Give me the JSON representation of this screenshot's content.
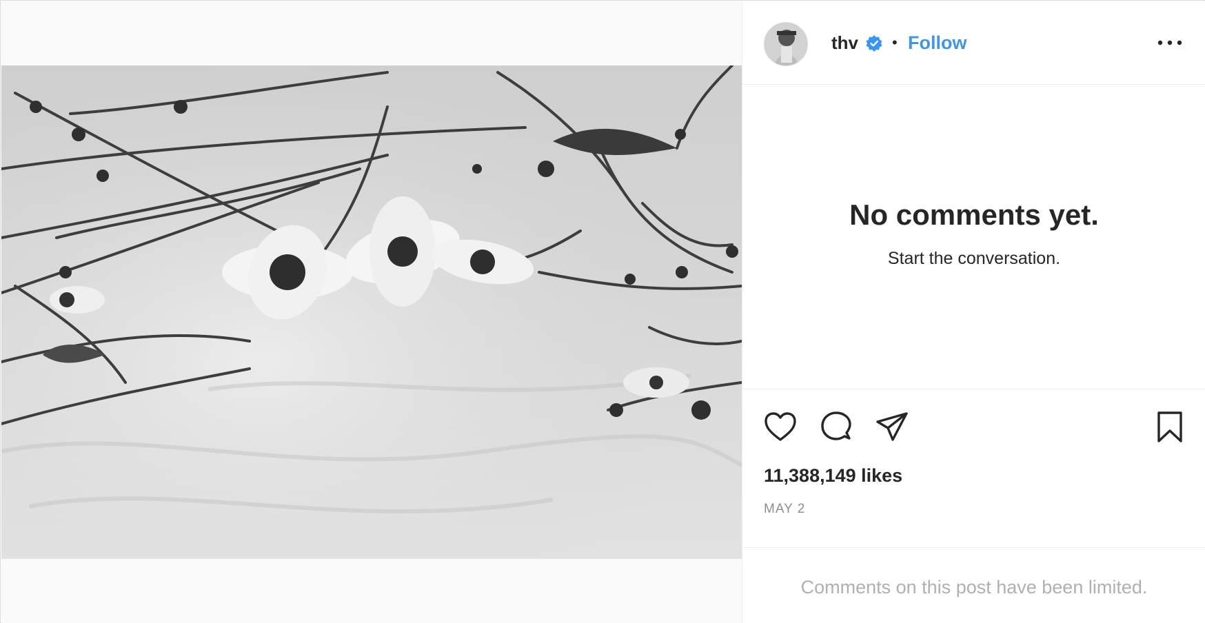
{
  "post": {
    "username": "thv",
    "verified": true,
    "separator": "•",
    "follow_label": "Follow",
    "more_options": "more-options-icon"
  },
  "comments": {
    "empty_title": "No comments yet.",
    "empty_subtitle": "Start the conversation."
  },
  "actions": {
    "icons": [
      "heart-icon",
      "comment-icon",
      "share-icon",
      "bookmark-icon"
    ]
  },
  "stats": {
    "likes": "11,388,149 likes",
    "date": "MAY 2"
  },
  "footer": {
    "limited_notice": "Comments on this post have been limited."
  },
  "colors": {
    "accent": "#4096e3",
    "text": "#262626",
    "muted": "#8e8e8e",
    "border": "#efefef"
  }
}
